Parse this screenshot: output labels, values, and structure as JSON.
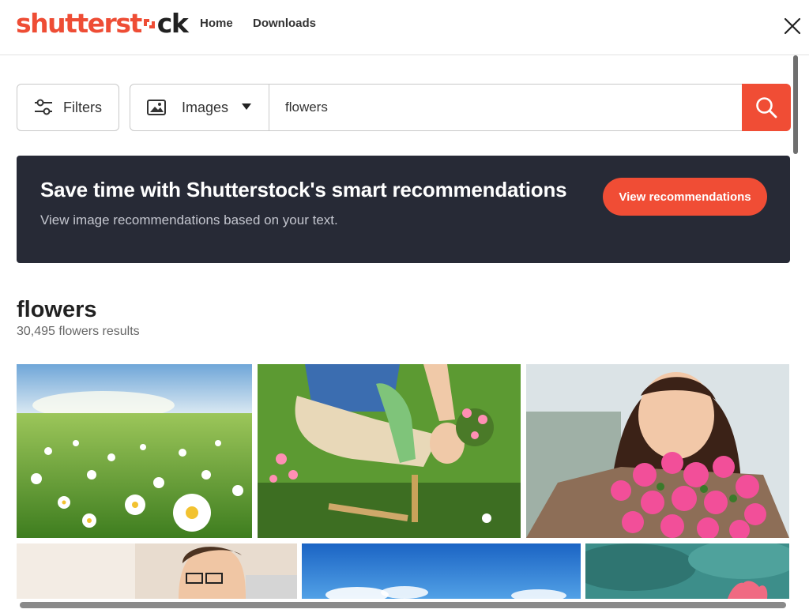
{
  "header": {
    "logo_main": "shutterst",
    "logo_ck": "ck",
    "nav": [
      "Home",
      "Downloads"
    ]
  },
  "search": {
    "filters_label": "Filters",
    "type_label": "Images",
    "query": "flowers",
    "icons": {
      "filters": "sliders-icon",
      "type": "image-icon",
      "dropdown": "caret-down-icon",
      "submit": "search-icon"
    }
  },
  "banner": {
    "title": "Save time with Shutterstock's smart recommendations",
    "subtitle": "View image recommendations based on your text.",
    "button_label": "View recommendations"
  },
  "results": {
    "title": "flowers",
    "count_text": "30,495 flowers results",
    "images": [
      {
        "subject": "daisy-meadow-photo"
      },
      {
        "subject": "person-gardening-pink-flowers-photo"
      },
      {
        "subject": "woman-smelling-pink-flowers-photo"
      },
      {
        "subject": "man-with-glasses-photo"
      },
      {
        "subject": "blue-sky-clouds-photo"
      },
      {
        "subject": "lotus-pond-photo"
      }
    ]
  },
  "colors": {
    "brand": "#f04d35",
    "banner_bg": "#272a36",
    "text": "#212121"
  }
}
